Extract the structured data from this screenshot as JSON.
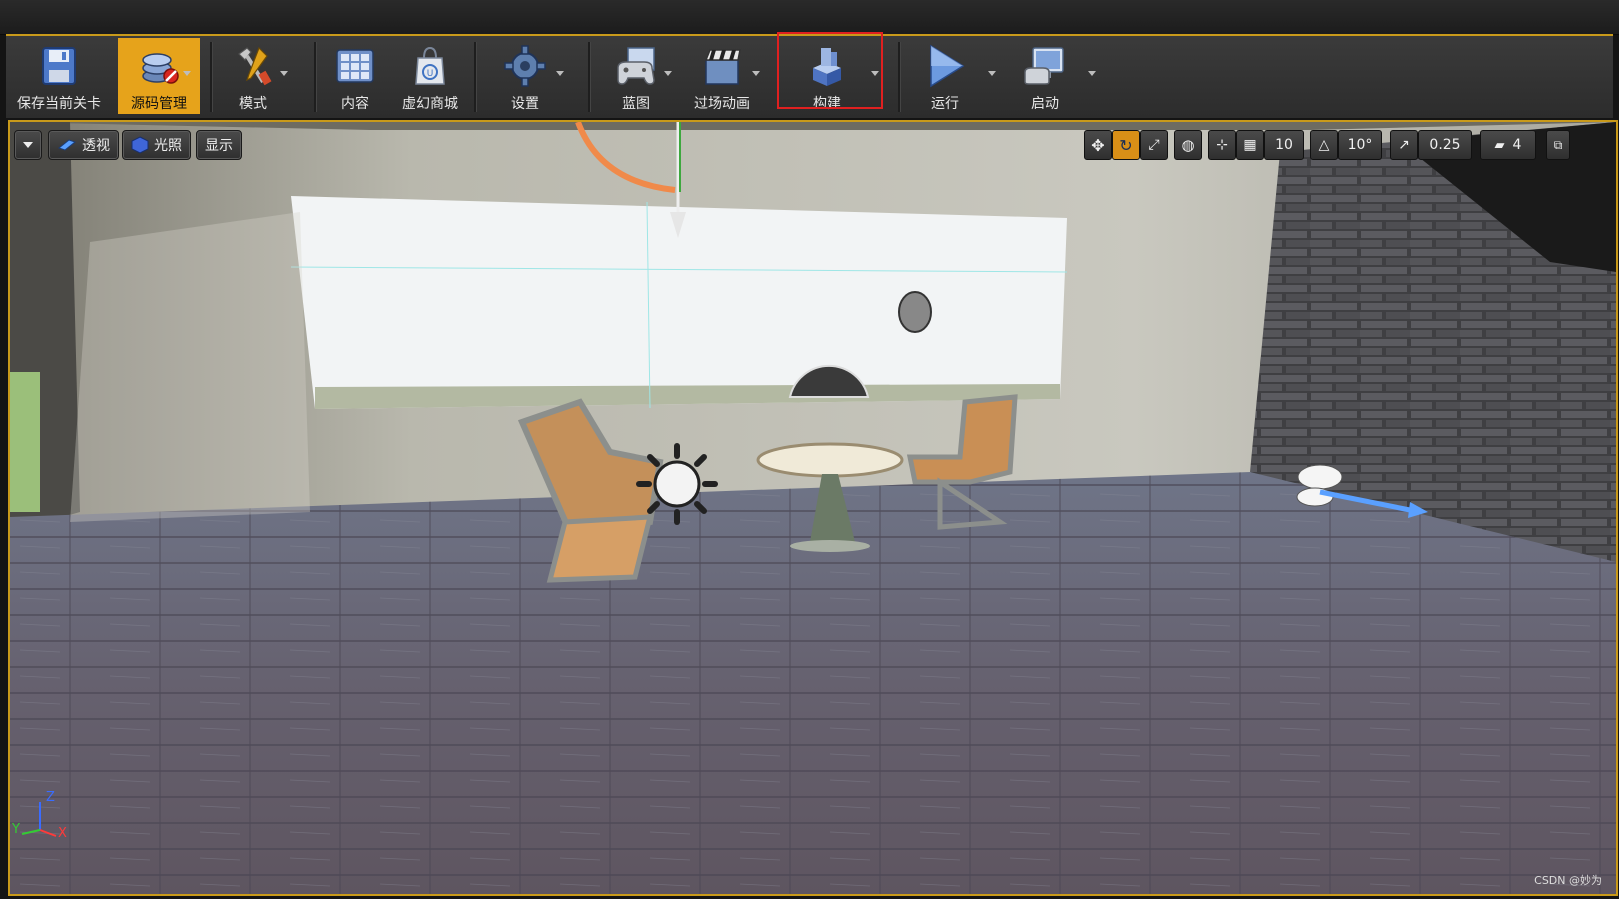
{
  "toolbar": {
    "buttons": [
      {
        "label": "保存当前关卡",
        "icon": "save-floppy-icon"
      },
      {
        "label": "源码管理",
        "icon": "source-control-icon",
        "active": true
      },
      {
        "label": "模式",
        "icon": "modes-tools-icon"
      },
      {
        "label": "内容",
        "icon": "content-grid-icon"
      },
      {
        "label": "虚幻商城",
        "icon": "marketplace-bag-icon"
      },
      {
        "label": "设置",
        "icon": "settings-gear-icon"
      },
      {
        "label": "蓝图",
        "icon": "blueprint-gamepad-icon"
      },
      {
        "label": "过场动画",
        "icon": "cinematics-clapper-icon"
      },
      {
        "label": "构建",
        "icon": "build-blocks-icon"
      },
      {
        "label": "运行",
        "icon": "play-icon"
      },
      {
        "label": "启动",
        "icon": "launch-monitor-icon"
      }
    ],
    "active_color": "#e6a31b"
  },
  "viewport": {
    "perspective_label": "透视",
    "lit_label": "光照",
    "show_label": "显示",
    "grid_snap_value": "10",
    "rotation_snap_value": "10°",
    "scale_snap_value": "0.25",
    "camera_speed_value": "4",
    "axis_x": "X",
    "axis_y": "Y",
    "axis_z": "Z"
  },
  "watermark": "CSDN @妙为",
  "colors": {
    "accent": "#c99a1a",
    "highlight_box": "#e02020"
  }
}
